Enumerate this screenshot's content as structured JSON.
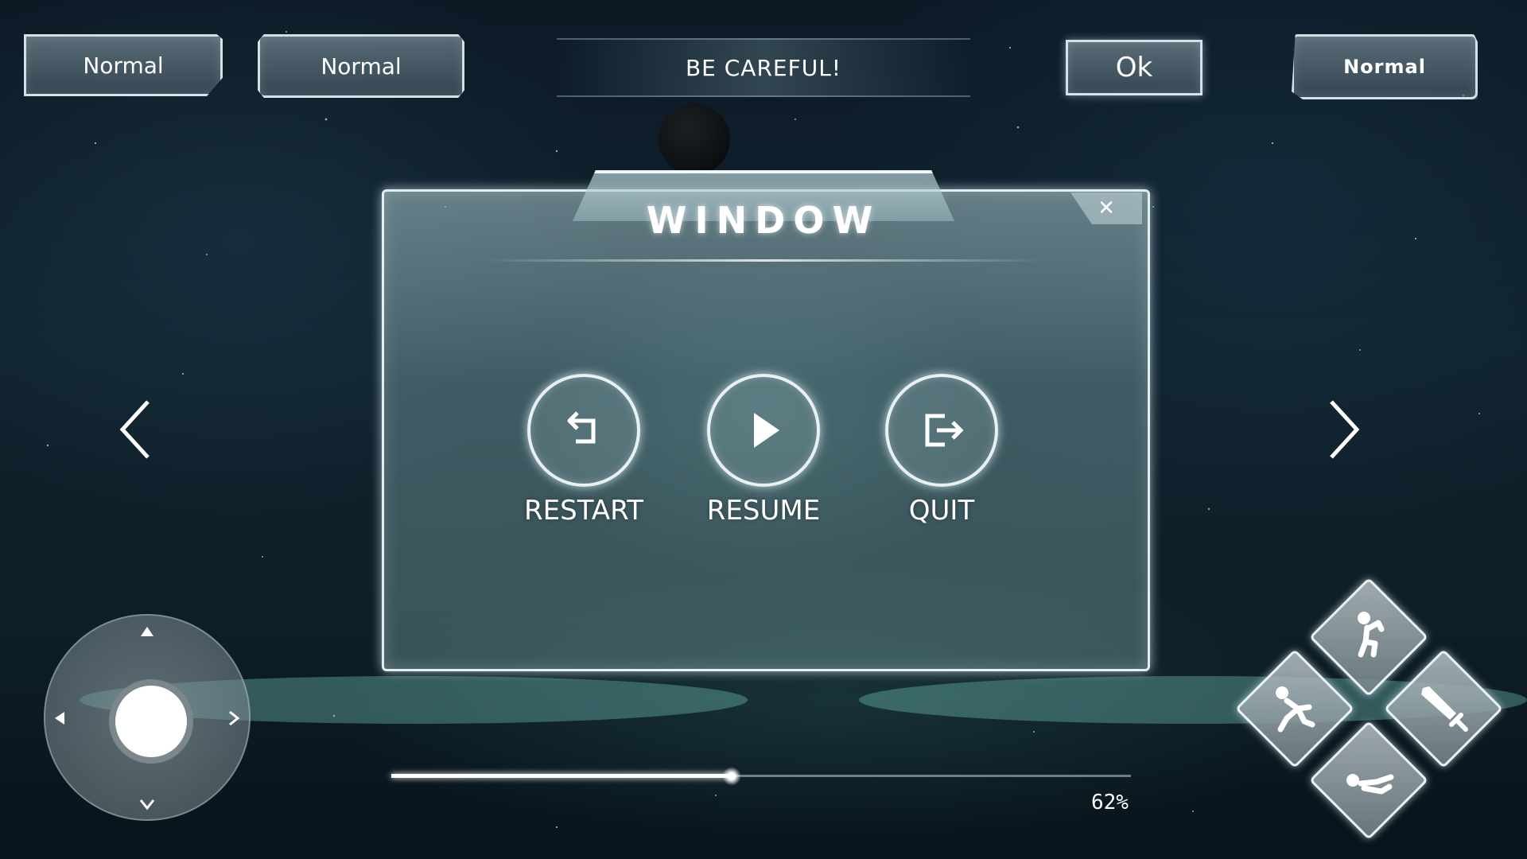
{
  "top_bar": {
    "button_normal_1": "Normal",
    "button_normal_2": "Normal",
    "banner_text": "BE CAREFUL!",
    "ok_button": "Ok",
    "button_normal_3": "Normal"
  },
  "window": {
    "title": "WINDOW",
    "close_icon": "close-icon",
    "actions": [
      {
        "label": "RESTART",
        "icon": "restart-icon"
      },
      {
        "label": "RESUME",
        "icon": "play-icon"
      },
      {
        "label": "QUIT",
        "icon": "exit-icon"
      }
    ]
  },
  "navigation": {
    "left_icon": "chevron-left-icon",
    "right_icon": "chevron-right-icon"
  },
  "progress": {
    "percent_label": "62%",
    "value": 0.46
  },
  "skills": [
    "jump-icon",
    "run-icon",
    "sword-icon",
    "crouch-icon"
  ],
  "colors": {
    "background": "#0c1a26",
    "panel_border": "#ebf5f8",
    "text": "#ffffff"
  }
}
